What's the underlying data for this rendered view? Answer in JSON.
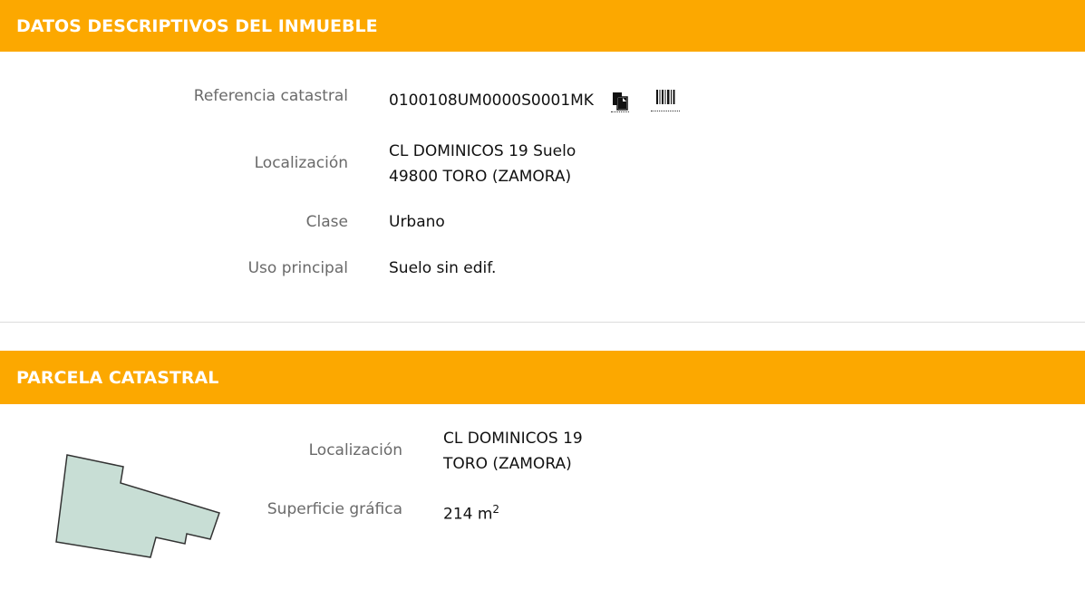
{
  "section1": {
    "title": "DATOS DESCRIPTIVOS DEL INMUEBLE",
    "referencia_label": "Referencia catastral",
    "referencia_value": "0100108UM0000S0001MK",
    "copy_icon": "copy-icon",
    "barcode_icon": "barcode-icon",
    "localizacion_label": "Localización",
    "localizacion_line1": "CL DOMINICOS 19 Suelo",
    "localizacion_line2": "49800 TORO (ZAMORA)",
    "clase_label": "Clase",
    "clase_value": "Urbano",
    "uso_label": "Uso principal",
    "uso_value": "Suelo sin edif."
  },
  "section2": {
    "title": "PARCELA CATASTRAL",
    "localizacion_label": "Localización",
    "localizacion_line1": "CL DOMINICOS 19",
    "localizacion_line2": "TORO (ZAMORA)",
    "superficie_label": "Superficie gráfica",
    "superficie_value": "214 m",
    "superficie_unit_exp": "2"
  },
  "colors": {
    "header_bg": "#fca800",
    "header_text": "#ffffff",
    "label_text": "#6a6a6a",
    "value_text": "#111111",
    "parcel_fill": "#c8ded5"
  }
}
